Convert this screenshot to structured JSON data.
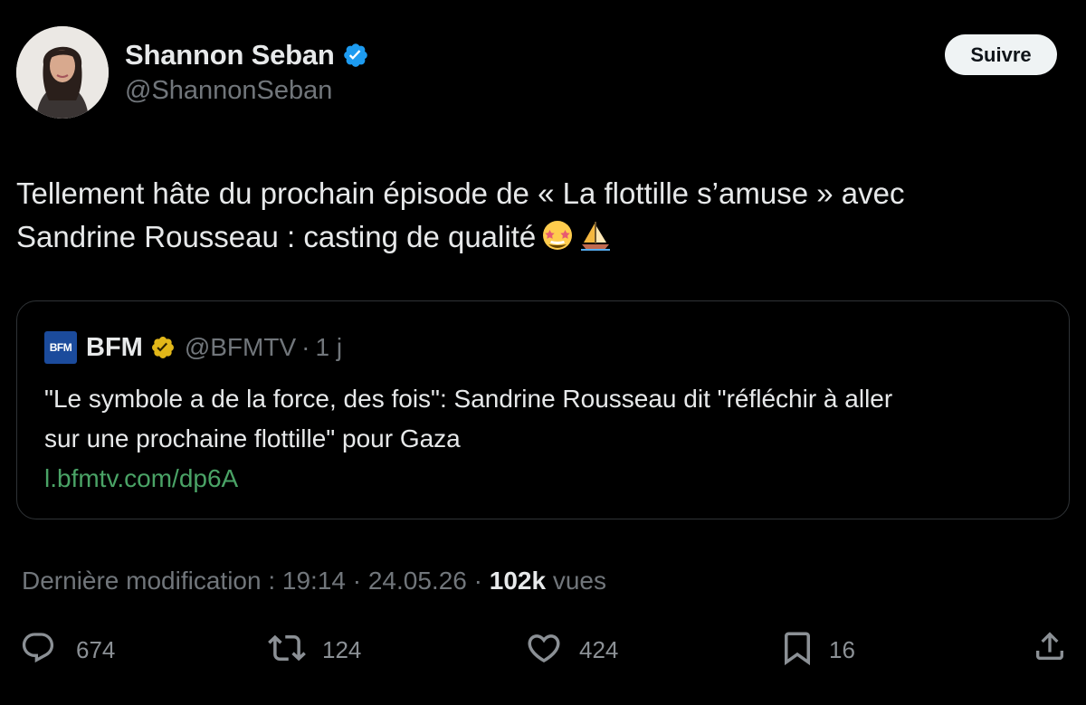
{
  "author": {
    "name": "Shannon Seban",
    "handle": "@ShannonSeban",
    "verified": true,
    "verified_color": "#1d9bf0"
  },
  "follow_button": {
    "label": "Suivre"
  },
  "tweet": {
    "line1": "Tellement hâte du prochain épisode de « La flottille s’amuse » avec",
    "line2": "Sandrine Rousseau : casting de qualité",
    "emojis": [
      "star-struck-emoji",
      "sailboat-emoji"
    ]
  },
  "quote": {
    "logo_text": "BFM",
    "name": "BFM",
    "badge_color": "#e2b719",
    "handle": "@BFMTV",
    "separator": "·",
    "time": "1 j",
    "text_line1": "\"Le symbole a de la force, des fois\": Sandrine Rousseau dit \"réfléchir à aller",
    "text_line2": "sur une prochaine flottille\" pour Gaza",
    "link": "l.bfmtv.com/dp6A",
    "link_color": "#4aa366"
  },
  "meta": {
    "edited_label": "Dernière modification : 19:14 · 24.05.26",
    "separator": " · ",
    "views_count": "102k",
    "views_label": " vues"
  },
  "actions": {
    "replies": "674",
    "reposts": "124",
    "likes": "424",
    "bookmarks": "16"
  }
}
